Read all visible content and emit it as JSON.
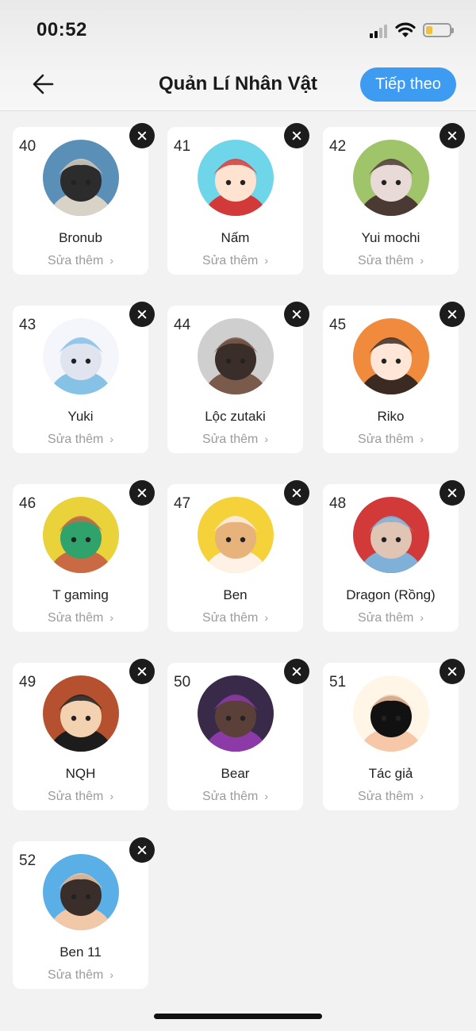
{
  "status_bar": {
    "time": "00:52"
  },
  "header": {
    "title": "Quản Lí Nhân Vật",
    "next_label": "Tiếp theo"
  },
  "colors": {
    "accent": "#3d9bf2",
    "battery": "#f0c23a"
  },
  "characters": [
    {
      "number": "40",
      "name": "Bronub",
      "edit_label": "Sửa thêm",
      "avatar_colors": [
        "#5a8fb8",
        "#2c2c2c",
        "#d9d2c6"
      ]
    },
    {
      "number": "41",
      "name": "Nấm",
      "edit_label": "Sửa thêm",
      "avatar_colors": [
        "#6fd6ea",
        "#ffe3d1",
        "#d23a3a"
      ]
    },
    {
      "number": "42",
      "name": "Yui mochi",
      "edit_label": "Sửa thêm",
      "avatar_colors": [
        "#9fc46a",
        "#e8dad6",
        "#4a3a33"
      ]
    },
    {
      "number": "43",
      "name": "Yuki",
      "edit_label": "Sửa thêm",
      "avatar_colors": [
        "#f4f6fb",
        "#dfe4ee",
        "#86c1e6"
      ]
    },
    {
      "number": "44",
      "name": "Lộc zutaki",
      "edit_label": "Sửa thêm",
      "avatar_colors": [
        "#cfcfcf",
        "#3a2e2a",
        "#7a5a4a"
      ]
    },
    {
      "number": "45",
      "name": "Riko",
      "edit_label": "Sửa thêm",
      "avatar_colors": [
        "#f08a3c",
        "#ffe6d6",
        "#3a2a22"
      ]
    },
    {
      "number": "46",
      "name": "T gaming",
      "edit_label": "Sửa thêm",
      "avatar_colors": [
        "#e9d23a",
        "#2fa36b",
        "#c96a45"
      ]
    },
    {
      "number": "47",
      "name": "Ben",
      "edit_label": "Sửa thêm",
      "avatar_colors": [
        "#f5d23a",
        "#e8b37a",
        "#fff1e6"
      ]
    },
    {
      "number": "48",
      "name": "Dragon (Rồng)",
      "edit_label": "Sửa thêm",
      "avatar_colors": [
        "#d23a3a",
        "#e0c4b4",
        "#7fb0d8"
      ]
    },
    {
      "number": "49",
      "name": "NQH",
      "edit_label": "Sửa thêm",
      "avatar_colors": [
        "#b5512e",
        "#f2d2b0",
        "#1c1c1c"
      ]
    },
    {
      "number": "50",
      "name": "Bear",
      "edit_label": "Sửa thêm",
      "avatar_colors": [
        "#3a2a4a",
        "#5a4038",
        "#8b3aa8"
      ]
    },
    {
      "number": "51",
      "name": "Tác giả",
      "edit_label": "Sửa thêm",
      "avatar_colors": [
        "#fff6e8",
        "#111111",
        "#f6c8a8"
      ]
    },
    {
      "number": "52",
      "name": "Ben 11",
      "edit_label": "Sửa thêm",
      "avatar_colors": [
        "#5ab0e6",
        "#3a2e2a",
        "#f2c9a8"
      ]
    }
  ]
}
